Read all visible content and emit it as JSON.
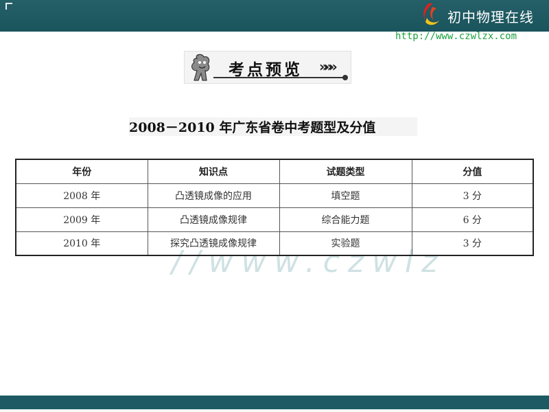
{
  "header": {
    "brand_name": "初中物理在线",
    "url": "http://www.czwlzx.com"
  },
  "watermark": "//www.czwlz",
  "section": {
    "title": "考点预览",
    "arrows": "»»»"
  },
  "table": {
    "title": "2008－2010 年广东省卷中考题型及分值",
    "headers": [
      "年份",
      "知识点",
      "试题类型",
      "分值"
    ],
    "rows": [
      [
        "2008 年",
        "凸透镜成像的应用",
        "填空题",
        "3 分"
      ],
      [
        "2009 年",
        "凸透镜成像规律",
        "综合能力题",
        "6 分"
      ],
      [
        "2010 年",
        "探究凸透镜成像规律",
        "实验题",
        "3 分"
      ]
    ]
  },
  "colors": {
    "frame": "#1d5a63",
    "url_green": "#1aa23c",
    "logo_red": "#d6251d",
    "logo_yellow": "#f2c21b"
  }
}
